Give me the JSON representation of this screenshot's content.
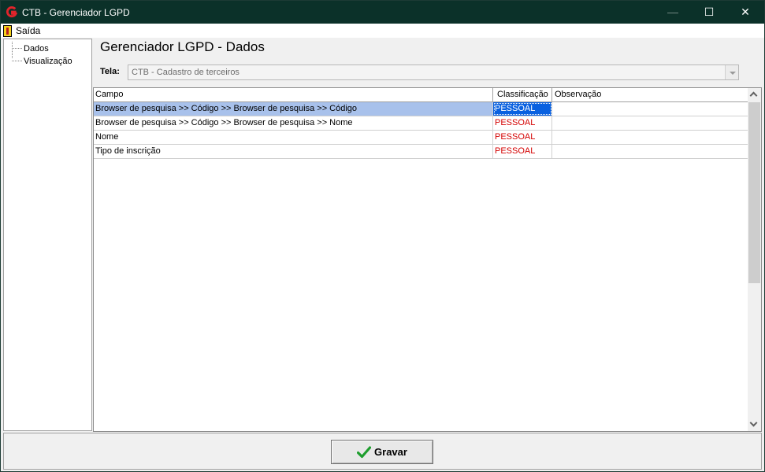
{
  "window": {
    "title": "CTB - Gerenciador LGPD",
    "minimize_glyph": "—",
    "maximize_glyph": "☐",
    "close_glyph": "✕"
  },
  "menu": {
    "exit_label": "Saída",
    "exit_icon": "exit-door-icon"
  },
  "tree": {
    "items": [
      {
        "label": "Dados"
      },
      {
        "label": "Visualização"
      }
    ]
  },
  "main": {
    "title": "Gerenciador LGPD - Dados",
    "tela_label": "Tela:",
    "tela_value": "CTB - Cadastro de terceiros"
  },
  "grid": {
    "columns": [
      "Campo",
      "Classificação",
      "Observação"
    ],
    "rows": [
      {
        "campo": "Browser de pesquisa >> Código >> Browser de pesquisa >> Código",
        "classificacao": "PESSOAL",
        "observacao": ""
      },
      {
        "campo": "Browser de pesquisa >> Código >> Browser de pesquisa >> Nome",
        "classificacao": "PESSOAL",
        "observacao": ""
      },
      {
        "campo": "Nome",
        "classificacao": "PESSOAL",
        "observacao": ""
      },
      {
        "campo": "Tipo de inscrição",
        "classificacao": "PESSOAL",
        "observacao": ""
      }
    ],
    "selected_row": 0
  },
  "footer": {
    "save_label": "Gravar",
    "save_icon": "check-icon"
  },
  "colors": {
    "titlebar": "#0b3129",
    "classification_text": "#d40000",
    "selection": "#a8c1eb",
    "selected_cell": "#0a61e0"
  }
}
